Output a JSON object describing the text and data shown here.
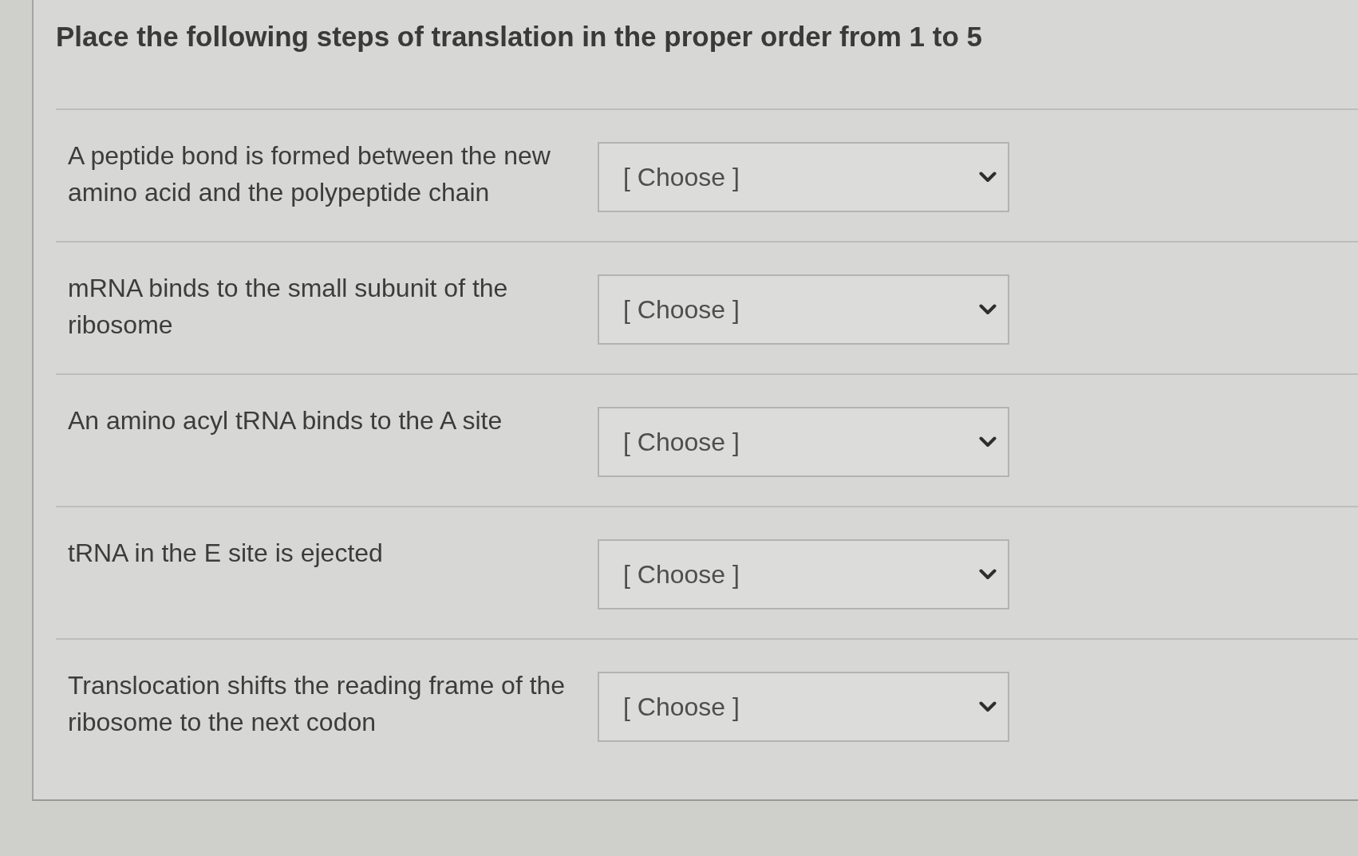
{
  "question": {
    "title": "Place the following steps of translation in the proper order from 1 to 5"
  },
  "steps": [
    {
      "text": "A peptide bond is formed between the new amino acid and the polypeptide chain",
      "dropdown": {
        "value": "[ Choose ]"
      }
    },
    {
      "text": "mRNA binds to the small subunit of the ribosome",
      "dropdown": {
        "value": "[ Choose ]"
      }
    },
    {
      "text": "An amino acyl tRNA binds to the A site",
      "dropdown": {
        "value": "[ Choose ]"
      }
    },
    {
      "text": "tRNA in the E site is ejected",
      "dropdown": {
        "value": "[ Choose ]"
      }
    },
    {
      "text": "Translocation shifts the reading frame of the ribosome to the next codon",
      "dropdown": {
        "value": "[ Choose ]"
      }
    }
  ]
}
